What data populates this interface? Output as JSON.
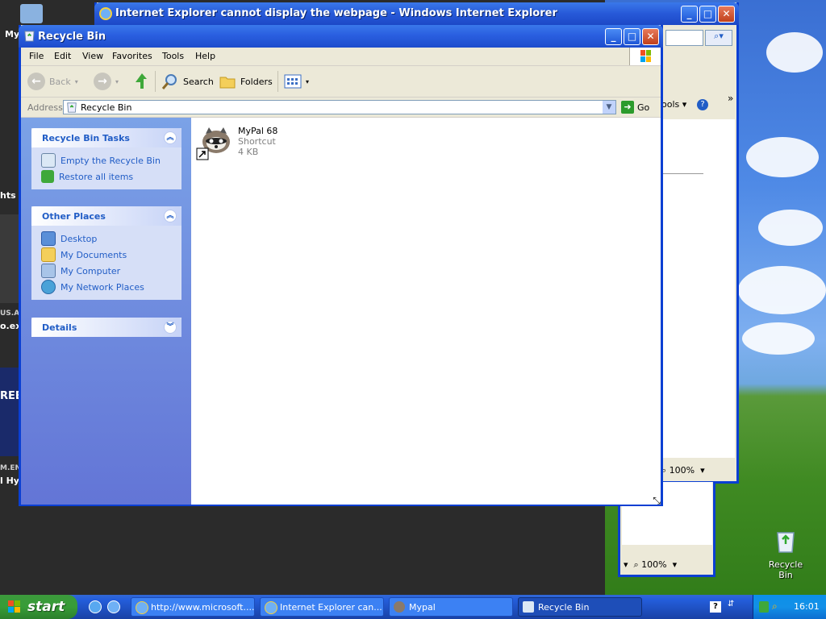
{
  "desktop": {
    "recycle_icon_label": "Recycle Bin",
    "partial_texts": [
      "My",
      "hts",
      "US.A",
      "o.exe",
      "REE",
      "M.EN",
      "l Hyp"
    ]
  },
  "ie_window": {
    "title": "Internet Explorer cannot display the webpage - Windows Internet Explorer",
    "tools_label": "ools",
    "zoom": "100%"
  },
  "ie_window2": {
    "zoom": "100%"
  },
  "explorer": {
    "title": "Recycle Bin",
    "menu": [
      "File",
      "Edit",
      "View",
      "Favorites",
      "Tools",
      "Help"
    ],
    "toolbar": {
      "back": "Back",
      "search": "Search",
      "folders": "Folders"
    },
    "address": {
      "label": "Address",
      "value": "Recycle Bin",
      "go": "Go"
    },
    "tasks_panel": {
      "title": "Recycle Bin Tasks",
      "items": [
        "Empty the Recycle Bin",
        "Restore all items"
      ]
    },
    "places_panel": {
      "title": "Other Places",
      "items": [
        "Desktop",
        "My Documents",
        "My Computer",
        "My Network Places"
      ]
    },
    "details_panel": {
      "title": "Details"
    },
    "files": [
      {
        "name": "MyPal 68",
        "type": "Shortcut",
        "size": "4 KB"
      }
    ]
  },
  "taskbar": {
    "start": "start",
    "tasks": [
      {
        "label": "http://www.microsoft...."
      },
      {
        "label": "Internet Explorer can..."
      },
      {
        "label": "Mypal"
      },
      {
        "label": "Recycle Bin"
      }
    ],
    "clock": "16:01"
  },
  "colors": {
    "title_blue": "#0a3fd3",
    "panel_link": "#215dc6",
    "start_green": "#379c37"
  }
}
